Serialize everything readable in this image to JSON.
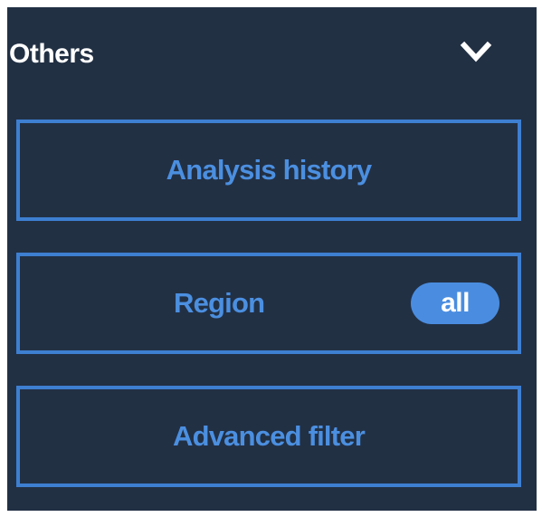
{
  "section": {
    "title": "Others",
    "toggle_icon": "chevron-down-icon"
  },
  "buttons": {
    "history_label": "Analysis history",
    "region_label": "Region",
    "region_badge": "all",
    "filter_label": "Advanced filter"
  },
  "colors": {
    "panel_bg": "#223044",
    "accent": "#3d7fd1",
    "text_accent": "#4b8fe0",
    "badge_bg": "#4a8de0",
    "title_text": "#ffffff"
  }
}
